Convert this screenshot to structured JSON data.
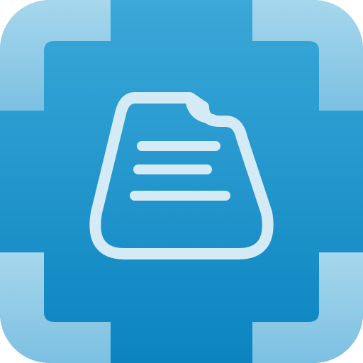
{
  "icon": {
    "name": "document-scanner-app-icon",
    "depicts": "document-icon",
    "colors": {
      "background_top": "#3aa8d8",
      "background_bottom": "#0b84c0",
      "corner_brackets_top": "#a6d7ec",
      "corner_brackets_bottom": "#7cc0e2",
      "document_fill_top": "#2f9fd3",
      "document_fill_bottom": "#1a8fc8",
      "document_outline": "#d4ebf6",
      "document_lines": "#d4ebf6"
    }
  }
}
